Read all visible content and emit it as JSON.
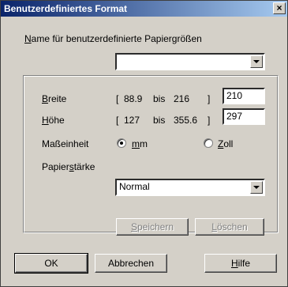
{
  "window": {
    "title": "Benutzerdefiniertes Format",
    "close_label": "×"
  },
  "name_section": {
    "label_accel": "N",
    "label_rest": "ame für benutzerdefinierte Papiergrößen",
    "value": ""
  },
  "width_row": {
    "label_accel": "B",
    "label_rest": "reite",
    "range_open": "[",
    "min": "88.9",
    "bis": "bis",
    "max": "216",
    "range_close": "]",
    "value": "210"
  },
  "height_row": {
    "label_accel": "H",
    "label_rest": "öhe",
    "range_open": "[",
    "min": "127",
    "bis": "bis",
    "max": "355.6",
    "range_close": "]",
    "value": "297"
  },
  "unit": {
    "label": "Maßeinheit",
    "mm_accel": "m",
    "mm_rest": "m",
    "zoll_accel": "Z",
    "zoll_rest": "oll",
    "selected": "mm"
  },
  "paper_thickness": {
    "label_pre": "Papier",
    "label_accel": "s",
    "label_post": "tärke",
    "value": "Normal"
  },
  "buttons": {
    "save_accel": "S",
    "save_rest": "peichern",
    "delete_accel": "L",
    "delete_rest": "öschen",
    "ok": "OK",
    "cancel": "Abbrechen",
    "help_accel": "H",
    "help_rest": "ilfe"
  }
}
